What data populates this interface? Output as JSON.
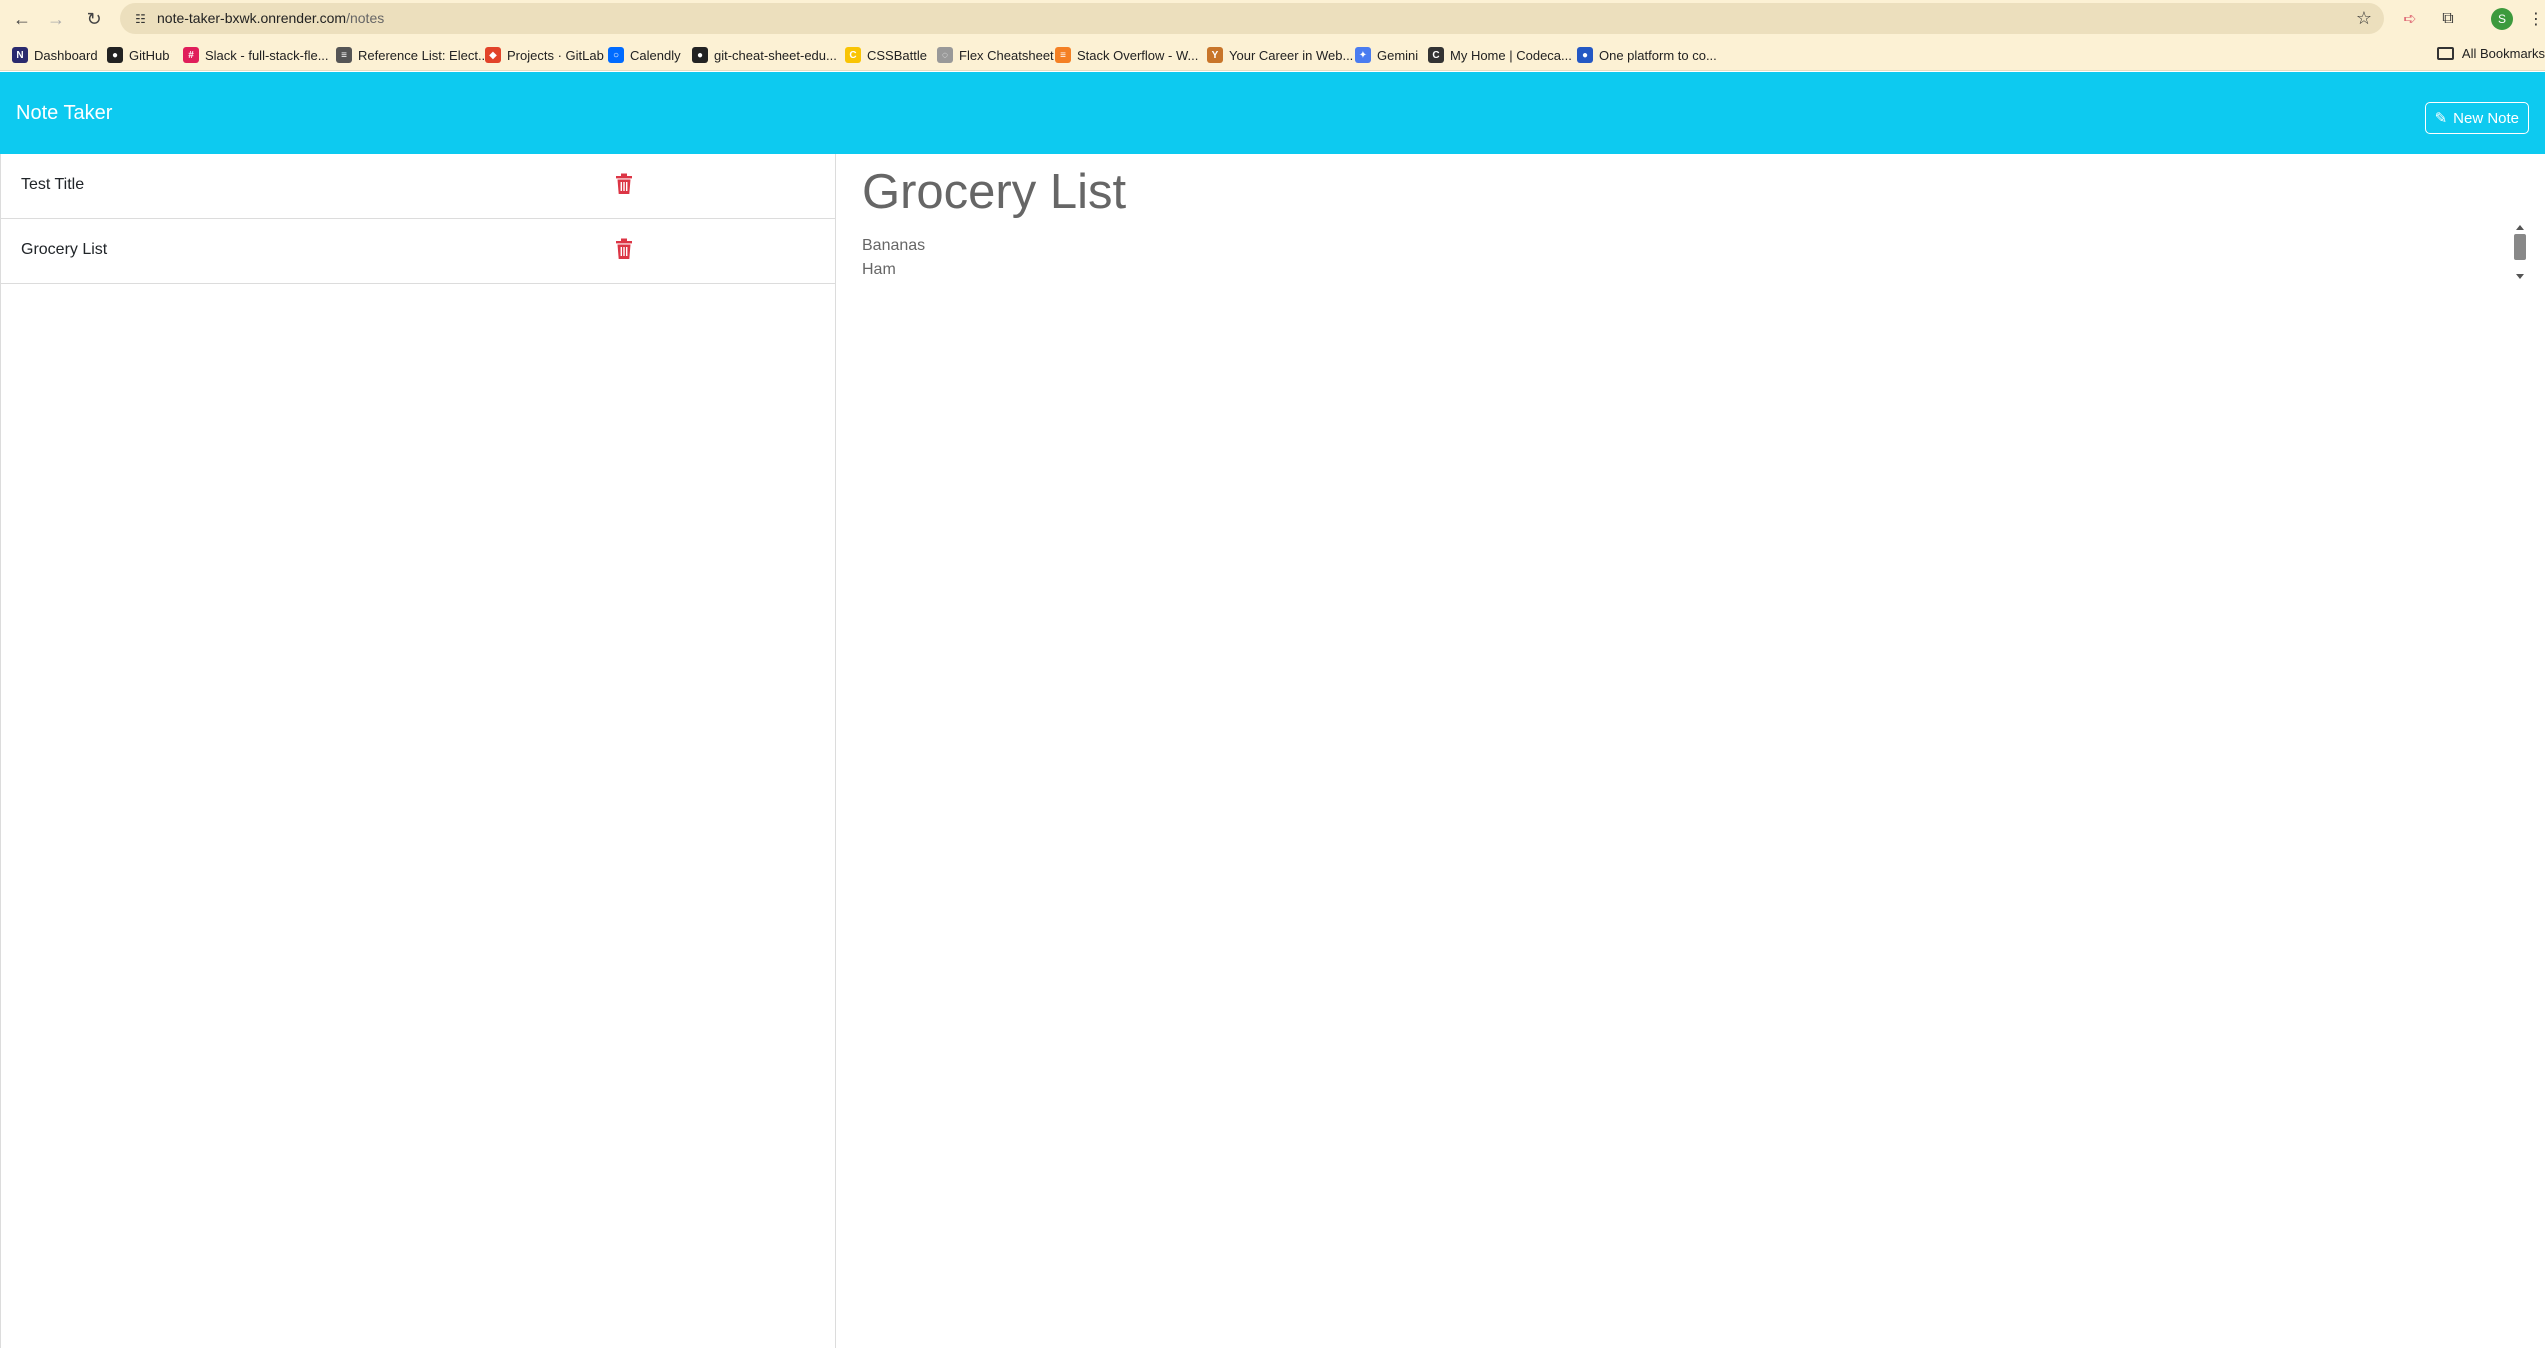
{
  "browser": {
    "url_host": "note-taker-bxwk.onrender.com",
    "url_path": "/notes",
    "profile_initial": "S",
    "bookmarks": [
      {
        "label": "Dashboard",
        "icon": "notion-icon",
        "color": "#2a2a6e",
        "glyph": "N"
      },
      {
        "label": "GitHub",
        "icon": "github-icon",
        "color": "#222222",
        "glyph": "●"
      },
      {
        "label": "Slack - full-stack-fle...",
        "icon": "slack-icon",
        "color": "#e01e5a",
        "glyph": "#"
      },
      {
        "label": "Reference List: Elect...",
        "icon": "page-icon",
        "color": "#555555",
        "glyph": "≡"
      },
      {
        "label": "Projects · GitLab",
        "icon": "gitlab-icon",
        "color": "#e24329",
        "glyph": "◆"
      },
      {
        "label": "Calendly",
        "icon": "calendly-icon",
        "color": "#006bff",
        "glyph": "○"
      },
      {
        "label": "git-cheat-sheet-edu...",
        "icon": "github-icon",
        "color": "#222222",
        "glyph": "●"
      },
      {
        "label": "CSSBattle",
        "icon": "cssbattle-icon",
        "color": "#f9c404",
        "glyph": "C"
      },
      {
        "label": "Flex Cheatsheet",
        "icon": "flex-icon",
        "color": "#999999",
        "glyph": "◌"
      },
      {
        "label": "Stack Overflow - W...",
        "icon": "stackoverflow-icon",
        "color": "#f48024",
        "glyph": "≡"
      },
      {
        "label": "Your Career in Web...",
        "icon": "career-icon",
        "color": "#c8752a",
        "glyph": "Y"
      },
      {
        "label": "Gemini",
        "icon": "gemini-icon",
        "color": "#4a7cf0",
        "glyph": "✦"
      },
      {
        "label": "My Home | Codeca...",
        "icon": "codecademy-icon",
        "color": "#333333",
        "glyph": "C"
      },
      {
        "label": "One platform to co...",
        "icon": "platform-icon",
        "color": "#2458c4",
        "glyph": "●"
      }
    ],
    "all_bookmarks_label": "All Bookmarks"
  },
  "app": {
    "brand": "Note Taker",
    "new_note_label": "New Note",
    "notes": [
      {
        "title": "Test Title"
      },
      {
        "title": "Grocery List"
      }
    ],
    "active_note": {
      "title": "Grocery List",
      "text_lines": [
        "Bananas",
        "Ham"
      ]
    },
    "colors": {
      "navbar": "#0dcaf0",
      "trash": "#dc3545"
    }
  }
}
